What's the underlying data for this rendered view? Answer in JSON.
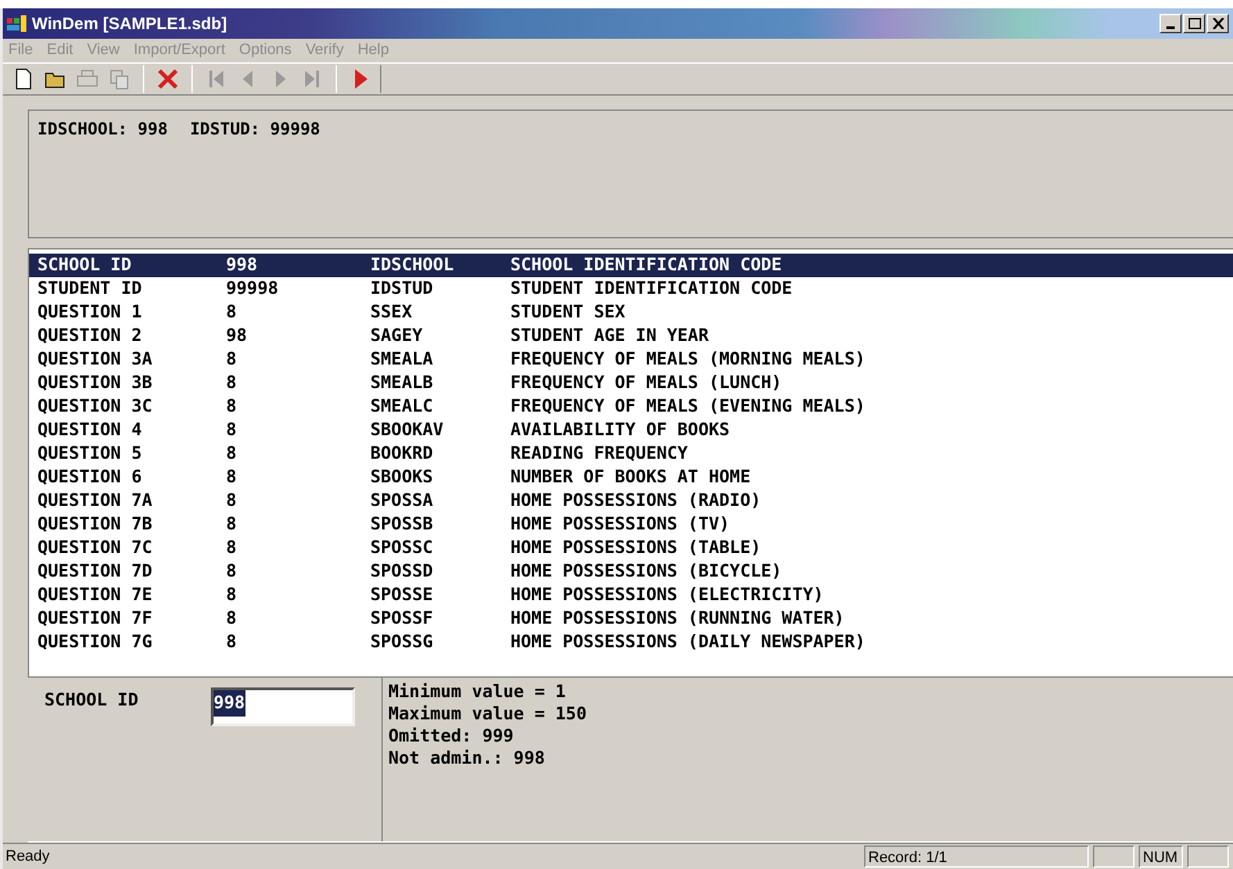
{
  "window": {
    "title": "WinDem [SAMPLE1.sdb]"
  },
  "menu": [
    "File",
    "Edit",
    "View",
    "Import/Export",
    "Options",
    "Verify",
    "Help"
  ],
  "toolbar": [
    {
      "kind": "new",
      "disabled": false
    },
    {
      "kind": "open",
      "disabled": false
    },
    {
      "kind": "print",
      "disabled": true
    },
    {
      "kind": "copy",
      "disabled": true
    },
    {
      "kind": "sep"
    },
    {
      "kind": "delete",
      "disabled": false
    },
    {
      "kind": "sep"
    },
    {
      "kind": "first",
      "disabled": true
    },
    {
      "kind": "prev",
      "disabled": true
    },
    {
      "kind": "next",
      "disabled": true
    },
    {
      "kind": "last",
      "disabled": true
    },
    {
      "kind": "sep"
    },
    {
      "kind": "run",
      "disabled": false
    }
  ],
  "header": [
    {
      "label": "IDSCHOOL:",
      "value": "998"
    },
    {
      "label": "IDSTUD:",
      "value": "99998"
    }
  ],
  "rows": [
    {
      "field": "SCHOOL ID",
      "value": "998",
      "variable": "IDSCHOOL",
      "description": "SCHOOL IDENTIFICATION CODE",
      "selected": true
    },
    {
      "field": "STUDENT ID",
      "value": "99998",
      "variable": "IDSTUD",
      "description": "STUDENT IDENTIFICATION CODE",
      "selected": false
    },
    {
      "field": "QUESTION 1",
      "value": "8",
      "variable": "SSEX",
      "description": "STUDENT SEX",
      "selected": false
    },
    {
      "field": "QUESTION 2",
      "value": "98",
      "variable": "SAGEY",
      "description": "STUDENT AGE IN YEAR",
      "selected": false
    },
    {
      "field": "QUESTION 3A",
      "value": "8",
      "variable": "SMEALA",
      "description": "FREQUENCY OF MEALS (MORNING MEALS)",
      "selected": false
    },
    {
      "field": "QUESTION 3B",
      "value": "8",
      "variable": "SMEALB",
      "description": "FREQUENCY OF MEALS (LUNCH)",
      "selected": false
    },
    {
      "field": "QUESTION 3C",
      "value": "8",
      "variable": "SMEALC",
      "description": "FREQUENCY OF MEALS (EVENING MEALS)",
      "selected": false
    },
    {
      "field": "QUESTION 4",
      "value": "8",
      "variable": "SBOOKAV",
      "description": "AVAILABILITY OF BOOKS",
      "selected": false
    },
    {
      "field": "QUESTION 5",
      "value": "8",
      "variable": "BOOKRD",
      "description": "READING FREQUENCY",
      "selected": false
    },
    {
      "field": "QUESTION 6",
      "value": "8",
      "variable": "SBOOKS",
      "description": "NUMBER OF BOOKS AT HOME",
      "selected": false
    },
    {
      "field": "QUESTION 7A",
      "value": "8",
      "variable": "SPOSSA",
      "description": "HOME POSSESSIONS (RADIO)",
      "selected": false
    },
    {
      "field": "QUESTION 7B",
      "value": "8",
      "variable": "SPOSSB",
      "description": "HOME POSSESSIONS (TV)",
      "selected": false
    },
    {
      "field": "QUESTION 7C",
      "value": "8",
      "variable": "SPOSSC",
      "description": "HOME POSSESSIONS (TABLE)",
      "selected": false
    },
    {
      "field": "QUESTION 7D",
      "value": "8",
      "variable": "SPOSSD",
      "description": "HOME POSSESSIONS (BICYCLE)",
      "selected": false
    },
    {
      "field": "QUESTION 7E",
      "value": "8",
      "variable": "SPOSSE",
      "description": "HOME POSSESSIONS (ELECTRICITY)",
      "selected": false
    },
    {
      "field": "QUESTION 7F",
      "value": "8",
      "variable": "SPOSSF",
      "description": "HOME POSSESSIONS (RUNNING WATER)",
      "selected": false
    },
    {
      "field": "QUESTION 7G",
      "value": "8",
      "variable": "SPOSSG",
      "description": "HOME POSSESSIONS (DAILY NEWSPAPER)",
      "selected": false
    }
  ],
  "editor": {
    "label": "SCHOOL ID",
    "value": "998",
    "info": [
      "Minimum value = 1",
      "Maximum value = 150",
      "Omitted: 999",
      "Not admin.: 998"
    ]
  },
  "status_bar": {
    "message": "Ready",
    "panels": [
      {
        "kind": "text",
        "text": "Record: 1/1"
      },
      {
        "kind": "blank"
      },
      {
        "kind": "text",
        "text": "NUM"
      },
      {
        "kind": "blank"
      }
    ]
  }
}
